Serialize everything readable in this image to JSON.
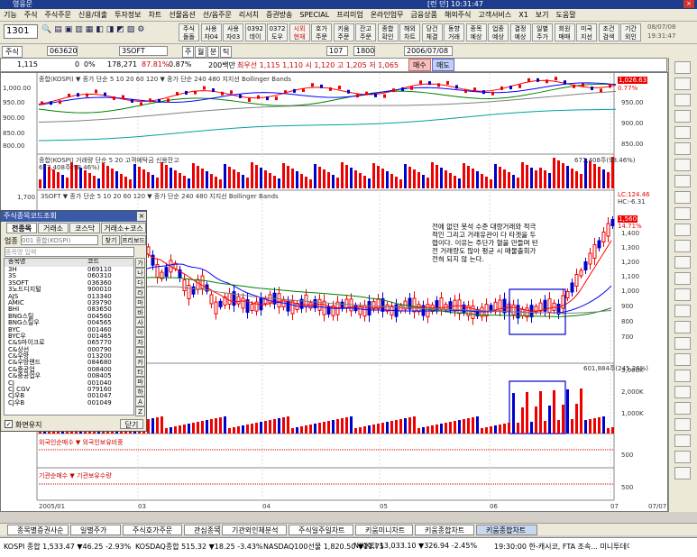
{
  "title": "영웅문",
  "titlebar_right": "[런 던] 10:31:47",
  "menu": [
    "기능",
    "주식",
    "주식주문",
    "신용/대출",
    "투자정보",
    "차트",
    "선물옵션",
    "선/옵주문",
    "리서치",
    "증권방송",
    "SPECIAL",
    "프리미엄",
    "온라인업무",
    "금융상품",
    "해외주식",
    "고객서비스",
    "X1",
    "보기",
    "도움말"
  ],
  "toolbar": {
    "screen_no": "1301",
    "buttons": [
      [
        "주식",
        "돌돌"
      ],
      [
        "사용",
        "자04"
      ],
      [
        "사용",
        "자03"
      ],
      [
        "0392",
        "데이"
      ],
      [
        "0372",
        "도우"
      ],
      [
        "시외",
        "현재"
      ],
      [
        "호가",
        "주문"
      ],
      [
        "키움",
        "주문"
      ],
      [
        "잔고",
        "주문"
      ],
      [
        "종합",
        "확인"
      ],
      [
        "해외",
        "차트"
      ],
      [
        "당건",
        "체결"
      ],
      [
        "동향",
        "거래"
      ],
      [
        "종목",
        "예상"
      ],
      [
        "업종",
        "예상"
      ],
      [
        "결정",
        "예상"
      ],
      [
        "일별",
        "주가"
      ],
      [
        "회원",
        "매매"
      ],
      [
        "미국",
        "지선"
      ],
      [
        "조건",
        "검색"
      ],
      [
        "기간",
        "외인"
      ]
    ],
    "date1": "08/07/08",
    "date2": "19:31:47"
  },
  "toolbar2": {
    "market": "주식",
    "code": "063620",
    "stock": "3SOFT",
    "period": [
      "주",
      "월",
      "분",
      "틱"
    ],
    "count": "107",
    "total": "1800",
    "date": "2006/07/08"
  },
  "quote": {
    "price": "1,115",
    "change": "0",
    "pct": "0%",
    "volume": "178,271",
    "ratio": "87.81%",
    "vr": "0.87%",
    "label200": "200백만",
    "prices": "최우선 1,115  1,110 시 1,120 고 1,205 저 1,065",
    "buy": "매수",
    "sell": "매도"
  },
  "panels": {
    "kospi_label": "종합(KOSPI) ▼ 종가 단순 5  10  20  60  120 ▼ 종가 단순 240  480  지지선  Bollinger Bands",
    "kospi_value": "1,000.00",
    "kospi_last": "1,026.63",
    "kospi_pct": "0.77%",
    "kospi_axis": [
      "950.00",
      "900.00",
      "850.00",
      "800.00"
    ],
    "kospi_vol_label": "종합(KOSPI) 거래량  단순 5  20  고객예탁금  신용잔고",
    "kospi_vol_left": "677,408주(98.46%)",
    "kospi_vol_right": "677,408주(98.46%)",
    "stock_label": "3SOFT ▼ 종가 단순 5  10  20  60  120 ▼ 종가 단순 240  480  지지선  Bollinger Bands",
    "stock_last": "LC:124.46",
    "stock_hc": "HC:-6.31",
    "stock_price": "1,560",
    "stock_pct": "14.71%",
    "stock_axis": [
      "1,700",
      "1,600",
      "1,400",
      "1,300",
      "1,200",
      "1,100",
      "1,000",
      "900",
      "800",
      "700"
    ],
    "stock_left_axis": [
      "1,700",
      "1,600"
    ],
    "vol_value": "601,884주(245.26%)",
    "vol_axis": [
      "3,000K",
      "2,000K",
      "1,000K"
    ],
    "foreign_label": "외국인순매수 ▼ 외국인보유비중",
    "foreign_axis": "500",
    "inst_label": "기관순매수 ▼ 기관보유수량",
    "inst_axis": "500",
    "x_labels": [
      "2005/01",
      "03",
      "04",
      "05",
      "06",
      "07"
    ],
    "x_right": "07/07"
  },
  "annotation": "전에 없던 봇석 수준 대량거래와 적극적인 그리고 거래유관이 다 타겟을 두렵이다. 이유는 주단가 혈을 만들며 턴전 거래량도 많아 평균 시 매물출회가 전혀 되지 않 는다.",
  "dialog": {
    "title": "주식종목코드조회",
    "tabs": [
      "전종목",
      "거래소",
      "코스닥",
      "거래소+코스닥"
    ],
    "market_label": "업종",
    "market_value": "001 종합(KOSPI)",
    "search_placeholder": "종목명 입력",
    "buttons": [
      "찾기",
      "프리보드"
    ],
    "col_name": "종목명",
    "col_code": "코드",
    "rows": [
      [
        "3H",
        "069110"
      ],
      [
        "3S",
        "060310"
      ],
      [
        "3SOFT",
        "036360"
      ],
      [
        "3노드디지털",
        "900010"
      ],
      [
        "AJS",
        "013340"
      ],
      [
        "AMIC",
        "039790"
      ],
      [
        "BHI",
        "083650"
      ],
      [
        "BNG스틸",
        "004560"
      ],
      [
        "BNG스틸우",
        "004565"
      ],
      [
        "BYC",
        "001460"
      ],
      [
        "BYC우",
        "001465"
      ],
      [
        "C&S마이크로",
        "065770"
      ],
      [
        "C&상선",
        "000790"
      ],
      [
        "C&우방",
        "013200"
      ],
      [
        "C&우방랜드",
        "084680"
      ],
      [
        "C&중공업",
        "008400"
      ],
      [
        "C&중공업우",
        "008405"
      ],
      [
        "CJ",
        "001040"
      ],
      [
        "CJ CGV",
        "079160"
      ],
      [
        "CJ우B",
        "001047"
      ],
      [
        "CJ우B",
        "001049"
      ]
    ],
    "hangul": [
      "가",
      "나",
      "다",
      "라",
      "마",
      "바",
      "사",
      "아",
      "자",
      "차",
      "카",
      "타",
      "파",
      "하",
      "A",
      "Z"
    ],
    "keep_label": "화면유지",
    "close_label": "닫기"
  },
  "taskbar": [
    "종목별증권사순",
    "일별주가",
    "주식호가주문",
    "관심종목",
    "기관외인체분석",
    "주식일주일차트",
    "키움미니차트",
    "키움종합차트",
    "키움종합차트"
  ],
  "ticker": {
    "kospi": "KOSPI 종합  1,533.47  ▼46.25  -2.93%",
    "kosdaq": "KOSDAQ종합  515.32  ▼18.25  -3.43%",
    "nasdaq": "NASDAQ100선물  1,820.50  ▼11.75",
    "nikkei": "NIKKEI  13,033.10  ▼326.94  -2.45%",
    "news": "19:30:00 한-캐시코, FTA 조속... 미니투데이"
  },
  "colors": {
    "up": "#e00000",
    "down": "#0000cc",
    "ma5": "#ff0000",
    "ma20": "#0000ff",
    "ma60": "#008000",
    "ma120": "#808080"
  }
}
